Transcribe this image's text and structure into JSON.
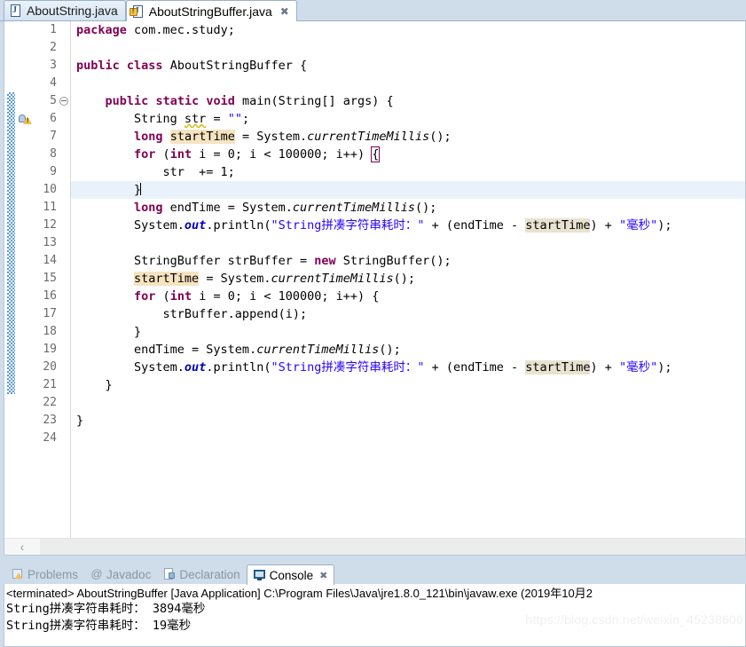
{
  "editor": {
    "tabs": [
      {
        "label": "AboutString.java",
        "icon": "java-file-icon",
        "active": false,
        "closable": false,
        "warning": false
      },
      {
        "label": "AboutStringBuffer.java",
        "icon": "java-file-icon",
        "active": true,
        "closable": true,
        "warning": true,
        "close_glyph": "✖"
      }
    ],
    "line_numbers": [
      "1",
      "2",
      "3",
      "4",
      "5",
      "6",
      "7",
      "8",
      "9",
      "10",
      "11",
      "12",
      "13",
      "14",
      "15",
      "16",
      "17",
      "18",
      "19",
      "20",
      "21",
      "22",
      "23",
      "24"
    ],
    "current_line": 10,
    "fold_marker_line": 5,
    "warning_marker_line": 6,
    "change_bar_from_line": 5,
    "change_bar_to_line": 21,
    "code_lines": [
      "package com.mec.study;",
      "",
      "public class AboutStringBuffer {",
      "",
      "    public static void main(String[] args) {",
      "        String str = \"\";",
      "        long startTime = System.currentTimeMillis();",
      "        for (int i = 0; i < 100000; i++) {",
      "            str  += 1;",
      "        }",
      "        long endTime = System.currentTimeMillis();",
      "        System.out.println(\"String拼凑字符串耗时：\" + (endTime - startTime) + \"毫秒\");",
      "",
      "        StringBuffer strBuffer = new StringBuffer();",
      "        startTime = System.currentTimeMillis();",
      "        for (int i = 0; i < 100000; i++) {",
      "            strBuffer.append(i);",
      "        }",
      "        endTime = System.currentTimeMillis();",
      "        System.out.println(\"String拼凑字符串耗时：\" + (endTime - startTime) + \"毫秒\");",
      "    }",
      "",
      "}",
      ""
    ],
    "scrollbar": {
      "left_arrow_glyph": "‹"
    }
  },
  "console_panel": {
    "tabs": [
      {
        "label": "Problems",
        "icon": "problems-icon",
        "active": false
      },
      {
        "label": "Javadoc",
        "icon": "javadoc-icon",
        "active": false
      },
      {
        "label": "Declaration",
        "icon": "declaration-icon",
        "active": false
      },
      {
        "label": "Console",
        "icon": "console-icon",
        "active": true
      }
    ],
    "close_glyph": "✖",
    "javadoc_glyph": "@",
    "header_line": "<terminated> AboutStringBuffer [Java Application] C:\\Program Files\\Java\\jre1.8.0_121\\bin\\javaw.exe (2019年10月2",
    "output_lines": [
      "String拼凑字符串耗时： 3894毫秒",
      "String拼凑字符串耗时： 19毫秒"
    ]
  },
  "watermark": {
    "text": "https://blog.csdn.net/weixin_45238600"
  },
  "colors": {
    "keyword": "#7f0055",
    "string": "#2a00ff",
    "field": "#0000c0",
    "chrome": "#cfdcea",
    "current_line": "#e9f2fb",
    "occurrence": "#e8e2d0",
    "write_occurrence": "#f6e3c0",
    "change_bar": "#5b9bd5"
  }
}
